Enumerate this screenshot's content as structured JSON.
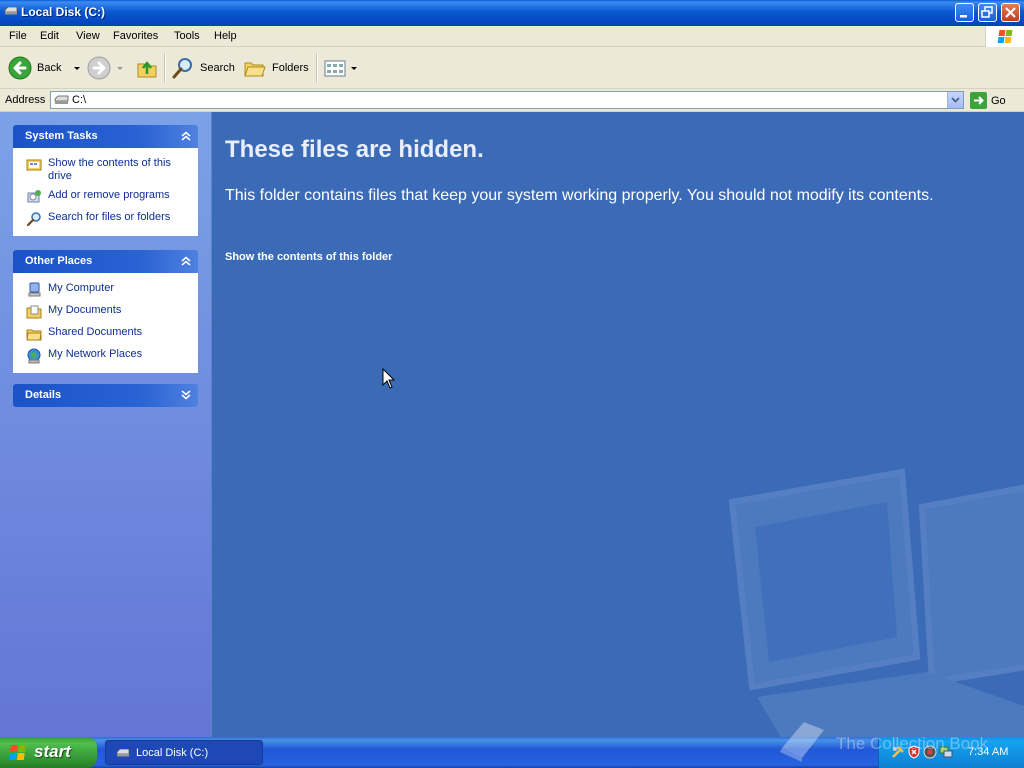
{
  "window": {
    "title": "Local Disk (C:)"
  },
  "menu": [
    "File",
    "Edit",
    "View",
    "Favorites",
    "Tools",
    "Help"
  ],
  "toolbar": {
    "back_label": "Back",
    "search_label": "Search",
    "folders_label": "Folders"
  },
  "address": {
    "label": "Address",
    "value": "C:\\",
    "go_label": "Go"
  },
  "system_tasks": {
    "title": "System Tasks",
    "items": [
      {
        "label": "Show the contents of this drive",
        "icon": "drive-contents-icon"
      },
      {
        "label": "Add or remove programs",
        "icon": "add-remove-programs-icon"
      },
      {
        "label": "Search for files or folders",
        "icon": "search-icon"
      }
    ]
  },
  "other_places": {
    "title": "Other Places",
    "items": [
      {
        "label": "My Computer",
        "icon": "my-computer-icon"
      },
      {
        "label": "My Documents",
        "icon": "my-documents-icon"
      },
      {
        "label": "Shared Documents",
        "icon": "shared-folder-icon"
      },
      {
        "label": "My Network Places",
        "icon": "network-places-icon"
      }
    ]
  },
  "details": {
    "title": "Details"
  },
  "content": {
    "heading": "These files are hidden.",
    "description": "This folder contains files that keep your system working properly. You should not modify its contents.",
    "show_link": "Show the contents of this folder"
  },
  "taskbar": {
    "start_label": "start",
    "task_label": "Local Disk (C:)",
    "clock": "7:34 AM",
    "watermark": "The Collection Book"
  },
  "colors": {
    "title_blue": "#0a58d0",
    "content_blue": "#3b6bb7",
    "link_blue": "#0c2f93",
    "start_green": "#3c9a3c"
  }
}
